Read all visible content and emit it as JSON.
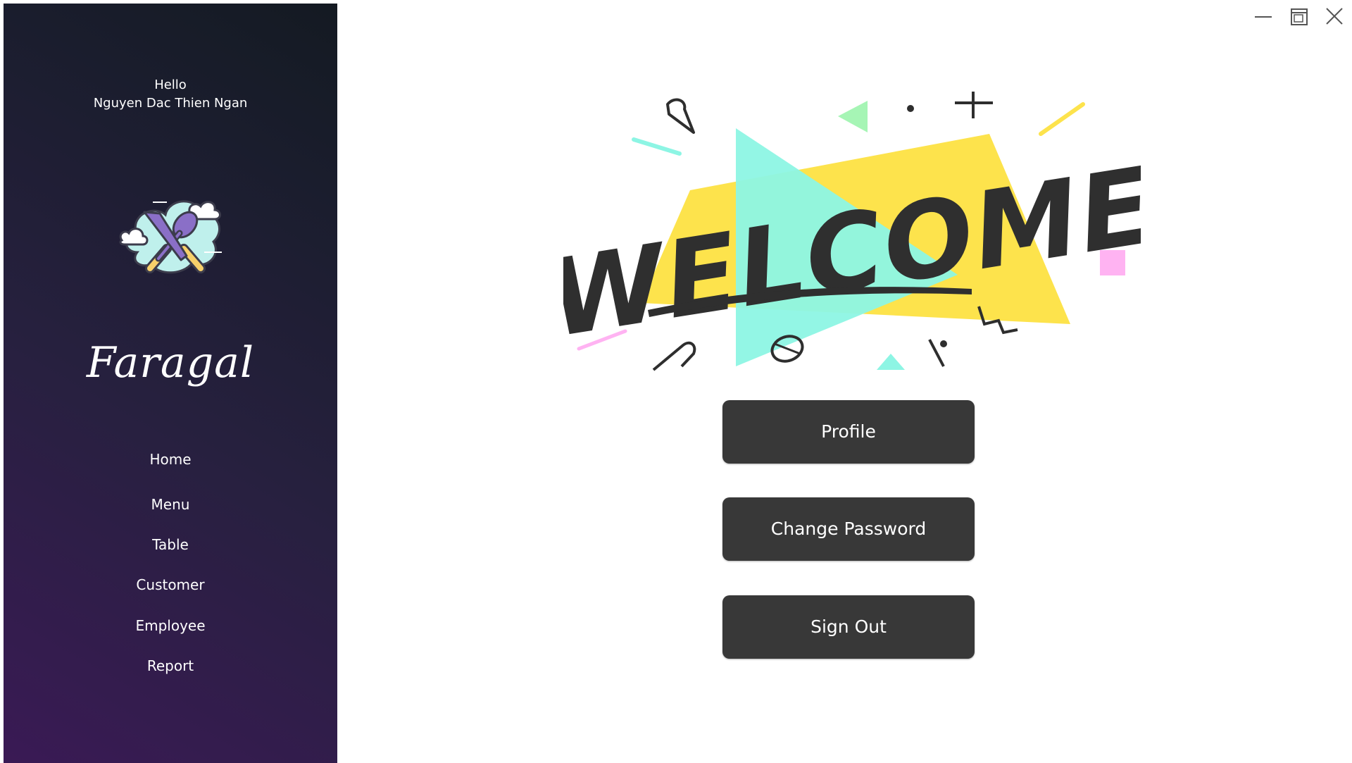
{
  "sidebar": {
    "greeting": "Hello",
    "user_name": "Nguyen Dac Thien Ngan",
    "brand_name": "Faragal",
    "logo_icon": "crossed-knife-spoon-cloud",
    "nav_items": [
      {
        "label": "Home"
      },
      {
        "label": "Menu"
      },
      {
        "label": "Table"
      },
      {
        "label": "Customer"
      },
      {
        "label": "Employee"
      },
      {
        "label": "Report"
      }
    ]
  },
  "window_controls": {
    "minimize_icon": "minimize-icon",
    "maximize_icon": "maximize-icon",
    "close_icon": "close-icon"
  },
  "main": {
    "banner_text": "WELCOME",
    "buttons": {
      "profile": "Profile",
      "change_password": "Change Password",
      "sign_out": "Sign Out"
    }
  },
  "colors": {
    "sidebar_dark": "#1a1d2d",
    "sidebar_purple": "#3a1a55",
    "button_bg": "#383838",
    "accent_yellow": "#fde34c",
    "accent_cyan": "#8df5e4",
    "accent_pink": "#ffb3f2",
    "accent_green": "#a6f5b5"
  }
}
